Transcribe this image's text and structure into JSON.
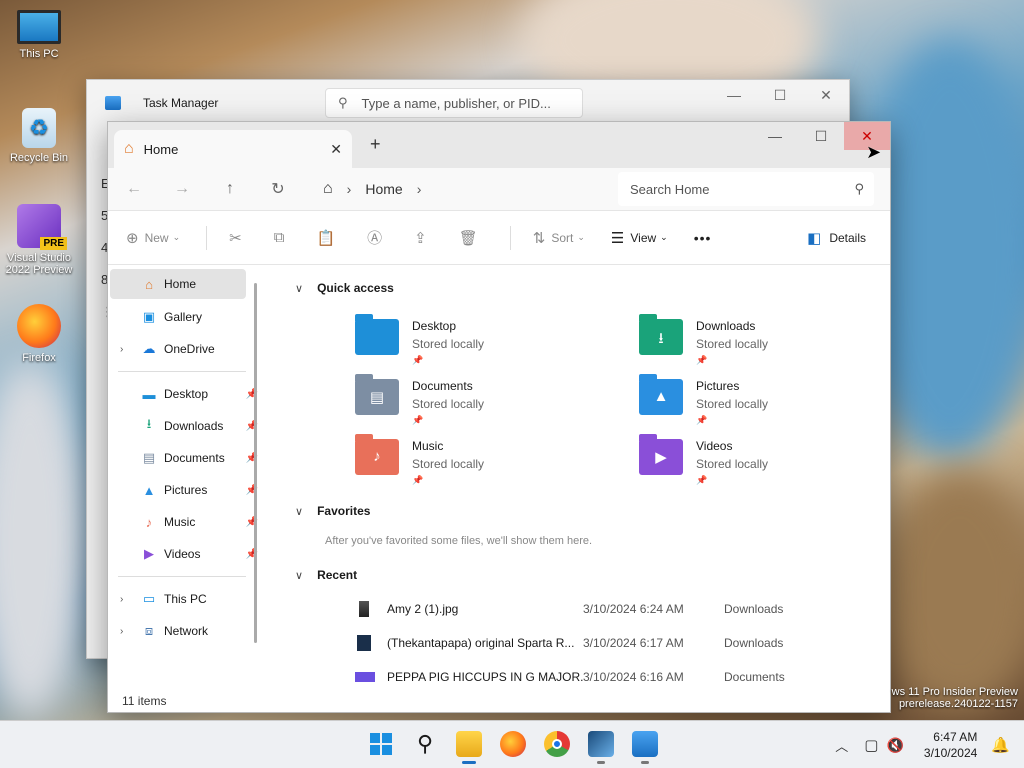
{
  "desktop": {
    "icons": [
      {
        "label": "This PC"
      },
      {
        "label": "Recycle Bin"
      },
      {
        "label": "Visual Studio 2022 Preview",
        "badge": "PRE"
      },
      {
        "label": "Firefox"
      }
    ],
    "watermark": [
      "ws 11 Pro Insider Preview",
      "prerelease.240122-1157"
    ]
  },
  "task_manager": {
    "title": "Task Manager",
    "search_placeholder": "Type a name, publisher, or PID..."
  },
  "explorer": {
    "tab_title": "Home",
    "breadcrumb": "Home",
    "search_placeholder": "Search Home",
    "commands": {
      "new": "New",
      "sort": "Sort",
      "view": "View",
      "more": "•••",
      "details": "Details"
    },
    "nav": {
      "top": [
        {
          "label": "Home",
          "icon": "home-icon"
        },
        {
          "label": "Gallery",
          "icon": "gallery-icon"
        },
        {
          "label": "OneDrive",
          "icon": "cloud-icon"
        }
      ],
      "pinned": [
        {
          "label": "Desktop",
          "icon": "desktop-folder-icon"
        },
        {
          "label": "Downloads",
          "icon": "download-icon"
        },
        {
          "label": "Documents",
          "icon": "document-icon"
        },
        {
          "label": "Pictures",
          "icon": "pictures-icon"
        },
        {
          "label": "Music",
          "icon": "music-icon"
        },
        {
          "label": "Videos",
          "icon": "videos-icon"
        }
      ],
      "bottom": [
        {
          "label": "This PC",
          "icon": "pc-icon"
        },
        {
          "label": "Network",
          "icon": "network-icon"
        }
      ]
    },
    "sections": {
      "quick_access": "Quick access",
      "favorites": "Favorites",
      "favorites_note": "After you've favorited some files, we'll show them here.",
      "recent": "Recent"
    },
    "quick_access": [
      {
        "name": "Desktop",
        "sub": "Stored locally",
        "color": "#1e8fd8"
      },
      {
        "name": "Downloads",
        "sub": "Stored locally",
        "color": "#1aa37a"
      },
      {
        "name": "Documents",
        "sub": "Stored locally",
        "color": "#7d8ea3"
      },
      {
        "name": "Pictures",
        "sub": "Stored locally",
        "color": "#2a8fe0"
      },
      {
        "name": "Music",
        "sub": "Stored locally",
        "color": "#e8705a"
      },
      {
        "name": "Videos",
        "sub": "Stored locally",
        "color": "#8a4fd8"
      }
    ],
    "recent": [
      {
        "name": "Amy 2 (1).jpg",
        "date": "3/10/2024 6:24 AM",
        "location": "Downloads"
      },
      {
        "name": "(Thekantapapa) original Sparta R...",
        "date": "3/10/2024 6:17 AM",
        "location": "Downloads"
      },
      {
        "name": "PEPPA PIG HICCUPS IN G MAJOR...",
        "date": "3/10/2024 6:16 AM",
        "location": "Documents"
      }
    ],
    "status": "11 items"
  },
  "taskbar": {
    "time": "6:47 AM",
    "date": "3/10/2024"
  }
}
